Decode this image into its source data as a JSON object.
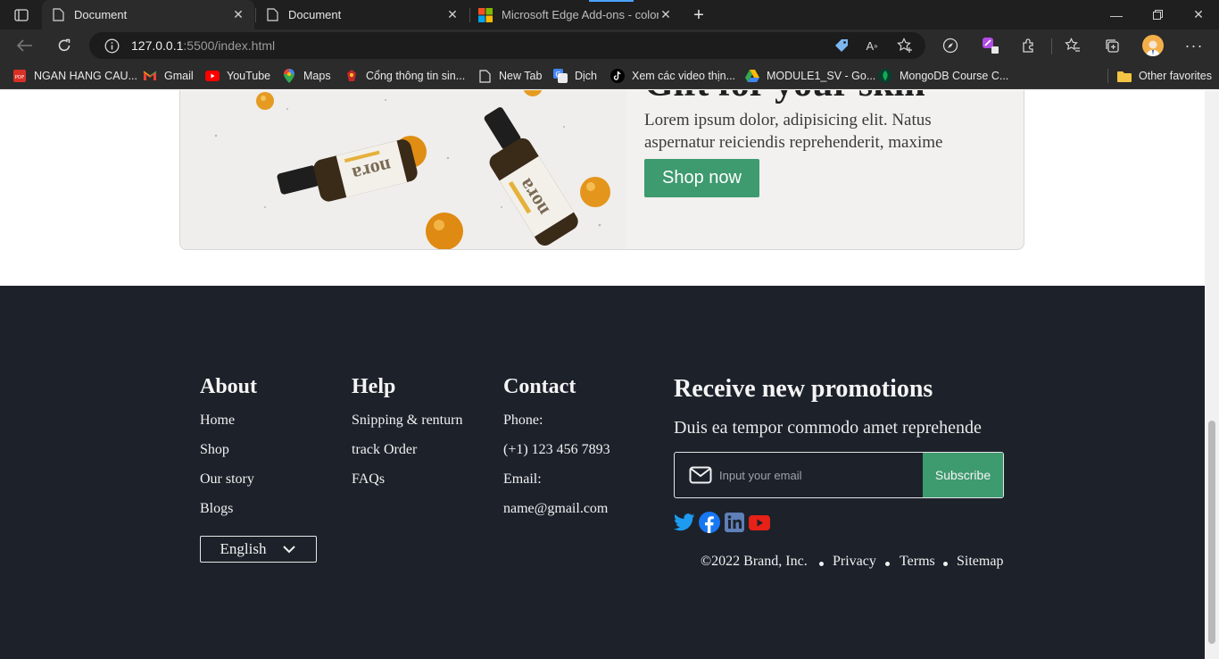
{
  "browser": {
    "tabs": [
      {
        "title": "Document",
        "active": true
      },
      {
        "title": "Document",
        "active": false
      },
      {
        "title": "Microsoft Edge Add-ons - color p",
        "active": false
      }
    ],
    "address": {
      "host": "127.0.0.1",
      "path": ":5500/index.html"
    },
    "bookmarks": [
      {
        "label": "NGAN HANG CAU...",
        "icon": "pdf-icon"
      },
      {
        "label": "Gmail",
        "icon": "gmail-icon"
      },
      {
        "label": "YouTube",
        "icon": "youtube-icon"
      },
      {
        "label": "Maps",
        "icon": "maps-icon"
      },
      {
        "label": "Cổng thông tin sin...",
        "icon": "portal-icon"
      },
      {
        "label": "New Tab",
        "icon": "page-icon"
      },
      {
        "label": "Dịch",
        "icon": "translate-icon"
      },
      {
        "label": "Xem các video thịn...",
        "icon": "tiktok-icon"
      },
      {
        "label": "MODULE1_SV - Go...",
        "icon": "drive-icon"
      },
      {
        "label": "MongoDB Course C...",
        "icon": "mongodb-icon"
      }
    ],
    "other_favorites": "Other favorites"
  },
  "banner": {
    "title": "Gift for your skin",
    "text": "Lorem ipsum dolor, adipisicing elit. Natus aspernatur reiciendis reprehenderit, maxime",
    "cta": "Shop now",
    "product_brand": "nora"
  },
  "footer": {
    "about": {
      "title": "About",
      "links": [
        "Home",
        "Shop",
        "Our story",
        "Blogs"
      ]
    },
    "help": {
      "title": "Help",
      "links": [
        "Snipping & renturn",
        "track Order",
        "FAQs"
      ]
    },
    "contact": {
      "title": "Contact",
      "lines": [
        "Phone:",
        "(+1) 123 456 7893",
        "Email:",
        "name@gmail.com"
      ]
    },
    "language": "English",
    "promo": {
      "title": "Receive new promotions",
      "subtitle": "Duis ea tempor commodo amet reprehende",
      "email_placeholder": "Input your email",
      "subscribe": "Subscribe"
    },
    "social": [
      "twitter-icon",
      "facebook-icon",
      "linkedin-icon",
      "youtube-icon"
    ],
    "legal": {
      "copyright": "©2022 Brand, Inc.",
      "privacy": "Privacy",
      "terms": "Terms",
      "sitemap": "Sitemap"
    }
  },
  "colors": {
    "accent_green": "#3e9a6f",
    "footer_bg": "#1c212a",
    "twitter": "#1d9bf0",
    "facebook": "#1877f2",
    "linkedin": "#0a66c2",
    "youtube": "#e62117"
  }
}
